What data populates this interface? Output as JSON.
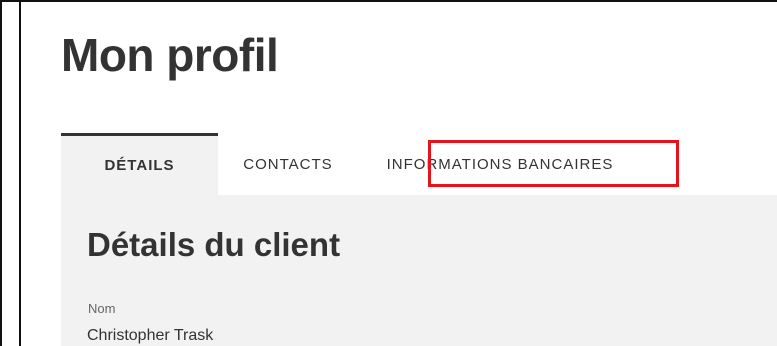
{
  "page": {
    "title": "Mon profil"
  },
  "tabs": [
    {
      "label": "DÉTAILS",
      "active": true
    },
    {
      "label": "CONTACTS",
      "active": false
    },
    {
      "label": "INFORMATIONS BANCAIRES",
      "active": false,
      "highlighted": true
    }
  ],
  "section": {
    "title": "Détails du client",
    "fields": [
      {
        "label": "Nom",
        "value": "Christopher Trask"
      }
    ]
  },
  "colors": {
    "text": "#333333",
    "panel_bg": "#f2f2f2",
    "active_tab_border": "#333333",
    "highlight": "#e8121b"
  }
}
